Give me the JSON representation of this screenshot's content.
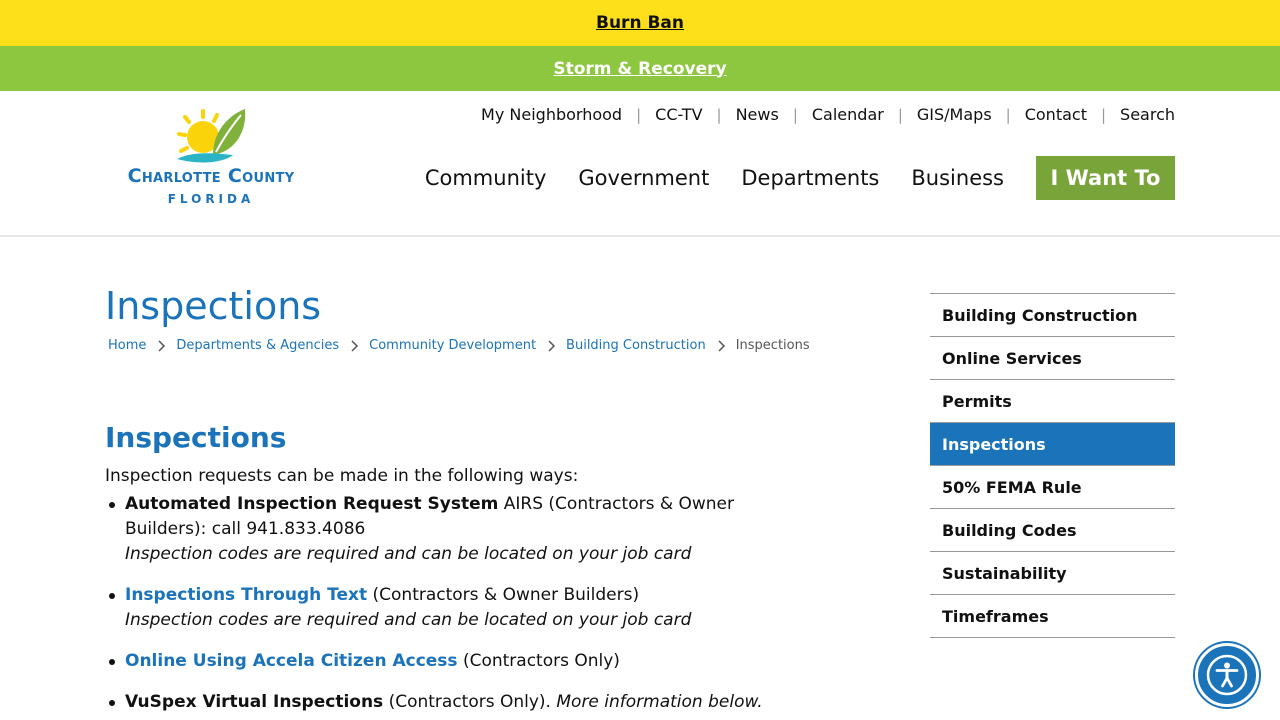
{
  "alerts": {
    "burn_ban": "Burn Ban",
    "storm": "Storm & Recovery"
  },
  "logo": {
    "name": "Charlotte County",
    "state": "FLORIDA"
  },
  "utility_nav": [
    "My Neighborhood",
    "CC-TV",
    "News",
    "Calendar",
    "GIS/Maps",
    "Contact",
    "Search"
  ],
  "main_nav": {
    "items": [
      "Community",
      "Government",
      "Departments",
      "Business"
    ],
    "cta": "I Want To"
  },
  "page": {
    "title": "Inspections"
  },
  "breadcrumb": {
    "links": [
      "Home",
      "Departments & Agencies",
      "Community Development",
      "Building Construction"
    ],
    "current": "Inspections"
  },
  "content": {
    "heading": "Inspections",
    "intro": "Inspection requests can be made in the following ways:",
    "methods": [
      {
        "title": "Automated Inspection Request System",
        "text": " AIRS (Contractors & Owner Builders): call 941.833.4086",
        "note": "Inspection codes are required and can be located on your job card"
      },
      {
        "title": "Inspections Through Text",
        "text": " (Contractors & Owner Builders)",
        "note": "Inspection codes are required and can be located on your job card"
      },
      {
        "title": "Online Using Accela Citizen Access",
        "text": " (Contractors Only)"
      },
      {
        "title": "VuSpex Virtual Inspections",
        "text": " (Contractors Only). ",
        "inline_note": "More information below."
      }
    ]
  },
  "sidenav": {
    "items": [
      "Building Construction",
      "Online Services",
      "Permits",
      "Inspections",
      "50% FEMA Rule",
      "Building Codes",
      "Sustainability",
      "Timeframes"
    ],
    "active": "Inspections"
  },
  "colors": {
    "alert_yellow": "#fde01a",
    "alert_green": "#8dc63f",
    "brand_blue": "#1b73b9",
    "cta_green": "#79a43a"
  },
  "icons": {
    "breadcrumb_separator": "chevron-right-icon",
    "accessibility": "accessibility-icon"
  }
}
